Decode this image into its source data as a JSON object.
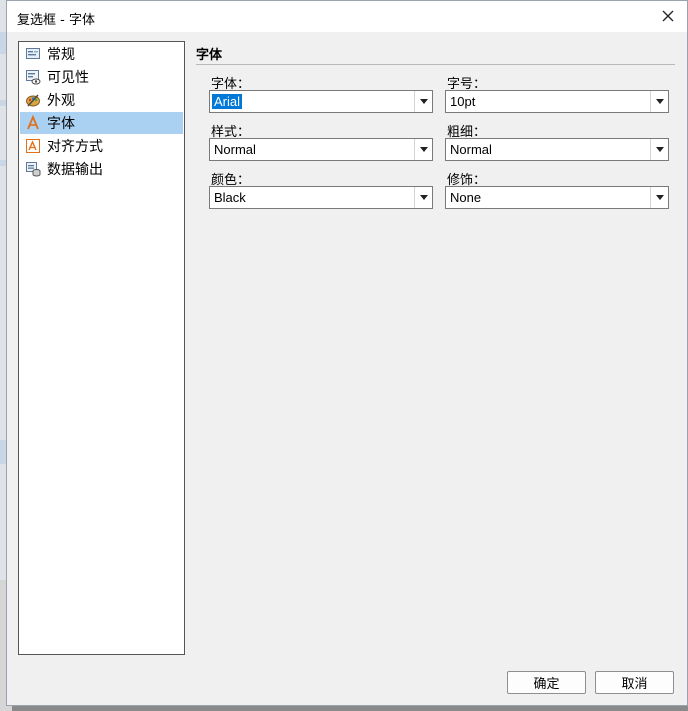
{
  "window": {
    "title": "复选框 - 字体"
  },
  "nav": {
    "items": [
      {
        "label": "常规",
        "icon": "general-icon",
        "selected": false
      },
      {
        "label": "可见性",
        "icon": "visibility-icon",
        "selected": false
      },
      {
        "label": "外观",
        "icon": "appearance-icon",
        "selected": false
      },
      {
        "label": "字体",
        "icon": "font-icon",
        "selected": true
      },
      {
        "label": "对齐方式",
        "icon": "alignment-icon",
        "selected": false
      },
      {
        "label": "数据输出",
        "icon": "data-output-icon",
        "selected": false
      }
    ]
  },
  "section": {
    "title": "字体"
  },
  "fields": {
    "font": {
      "label": "字体：",
      "value": "Arial"
    },
    "size": {
      "label": "字号：",
      "value": "10pt"
    },
    "style": {
      "label": "样式：",
      "value": "Normal"
    },
    "weight": {
      "label": "粗细：",
      "value": "Normal"
    },
    "color": {
      "label": "颜色：",
      "value": "Black"
    },
    "decoration": {
      "label": "修饰：",
      "value": "None"
    }
  },
  "buttons": {
    "ok": "确定",
    "cancel": "取消"
  },
  "colors": {
    "selection": "#aad0f2",
    "text_highlight": "#0078d7"
  }
}
